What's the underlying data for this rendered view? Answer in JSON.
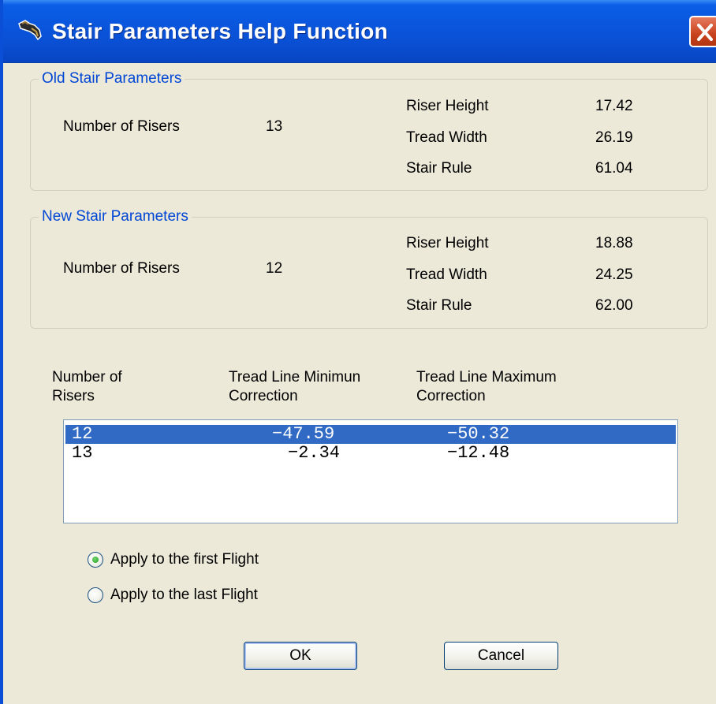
{
  "window": {
    "title": "Stair Parameters Help Function",
    "icons": {
      "app": "stair-tool-icon",
      "close": "close-icon"
    }
  },
  "old_params": {
    "legend": "Old Stair Parameters",
    "risers_label": "Number of Risers",
    "risers_value": "13",
    "riser_height_label": "Riser Height",
    "riser_height_value": "17.42",
    "tread_width_label": "Tread Width",
    "tread_width_value": "26.19",
    "stair_rule_label": "Stair Rule",
    "stair_rule_value": "61.04"
  },
  "new_params": {
    "legend": "New Stair Parameters",
    "risers_label": "Number of Risers",
    "risers_value": "12",
    "riser_height_label": "Riser Height",
    "riser_height_value": "18.88",
    "tread_width_label": "Tread Width",
    "tread_width_value": "24.25",
    "stair_rule_label": "Stair Rule",
    "stair_rule_value": "62.00"
  },
  "table": {
    "headers": [
      {
        "line1": "Number of",
        "line2": "Risers"
      },
      {
        "line1": "Tread Line Minimun",
        "line2": "Correction"
      },
      {
        "line1": "Tread Line Maximum",
        "line2": "Correction"
      }
    ],
    "rows": [
      {
        "risers": "12",
        "min": "−47.59",
        "max": "−50.32",
        "selected": true
      },
      {
        "risers": "13",
        "min": "−2.34",
        "max": "−12.48",
        "selected": false
      }
    ]
  },
  "options": {
    "first_flight": "Apply to the first Flight",
    "last_flight": "Apply to the last Flight",
    "selected": "first_flight"
  },
  "buttons": {
    "ok": "OK",
    "cancel": "Cancel"
  },
  "colors": {
    "title_bar": "#0a56dd",
    "accent": "#0046d5",
    "selection": "#316ac5",
    "close": "#c8421e"
  }
}
